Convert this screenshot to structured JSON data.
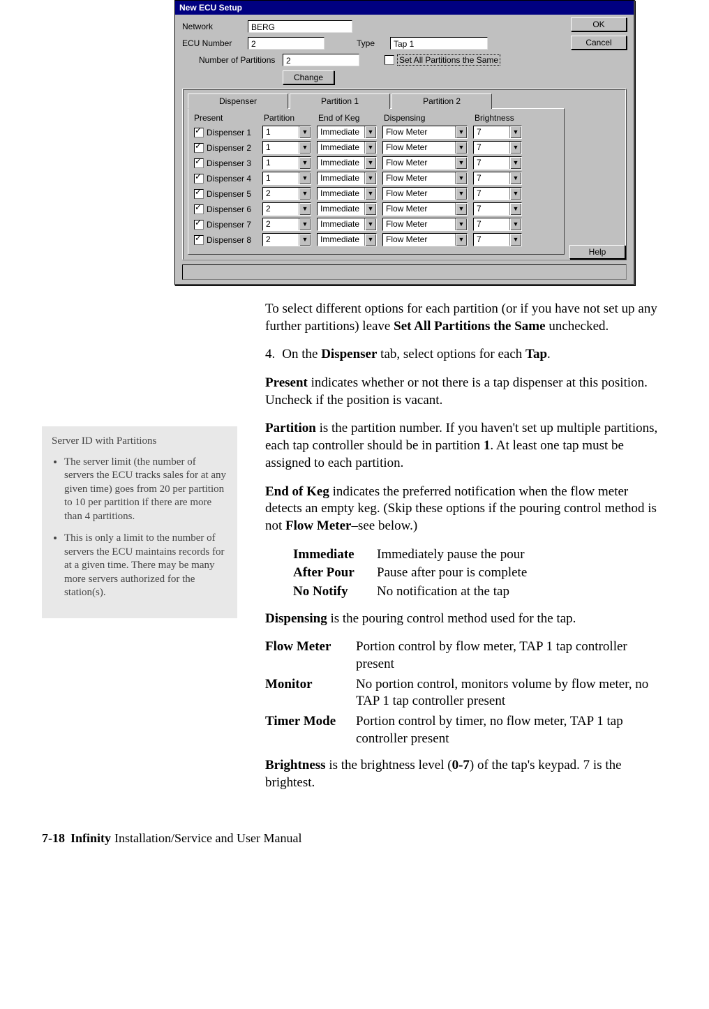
{
  "dialog": {
    "title": "New ECU Setup",
    "network_label": "Network",
    "network_value": "BERG",
    "ecu_num_label": "ECU Number",
    "ecu_num_value": "2",
    "type_label": "Type",
    "type_value": "Tap 1",
    "ok_label": "OK",
    "cancel_label": "Cancel",
    "help_label": "Help",
    "num_partitions_label": "Number of Partitions",
    "num_partitions_value": "2",
    "change_label": "Change",
    "set_all_label": "Set All Partitions the Same",
    "tabs": {
      "dispenser": "Dispenser",
      "p1": "Partition 1",
      "p2": "Partition 2"
    },
    "col_headers": {
      "present": "Present",
      "partition": "Partition",
      "eok": "End of Keg",
      "dispensing": "Dispensing",
      "brightness": "Brightness"
    },
    "rows": [
      {
        "name": "Dispenser 1",
        "partition": "1",
        "eok": "Immediate",
        "dispensing": "Flow Meter",
        "brightness": "7"
      },
      {
        "name": "Dispenser 2",
        "partition": "1",
        "eok": "Immediate",
        "dispensing": "Flow Meter",
        "brightness": "7"
      },
      {
        "name": "Dispenser 3",
        "partition": "1",
        "eok": "Immediate",
        "dispensing": "Flow Meter",
        "brightness": "7"
      },
      {
        "name": "Dispenser 4",
        "partition": "1",
        "eok": "Immediate",
        "dispensing": "Flow Meter",
        "brightness": "7"
      },
      {
        "name": "Dispenser 5",
        "partition": "2",
        "eok": "Immediate",
        "dispensing": "Flow Meter",
        "brightness": "7"
      },
      {
        "name": "Dispenser 6",
        "partition": "2",
        "eok": "Immediate",
        "dispensing": "Flow Meter",
        "brightness": "7"
      },
      {
        "name": "Dispenser 7",
        "partition": "2",
        "eok": "Immediate",
        "dispensing": "Flow Meter",
        "brightness": "7"
      },
      {
        "name": "Dispenser 8",
        "partition": "2",
        "eok": "Immediate",
        "dispensing": "Flow Meter",
        "brightness": "7"
      }
    ]
  },
  "doc": {
    "para_intro_1": "To select different options for each partition (or if you have not set up any further partitions) leave ",
    "para_intro_bold": "Set All Partitions the Same",
    "para_intro_2": " unchecked.",
    "step_num": "4.",
    "step_1a": "On the ",
    "step_1b": "Dispenser",
    "step_1c": " tab, select options for each ",
    "step_1d": "Tap",
    "step_1e": ".",
    "present_b": "Present",
    "present_t": " indicates whether or not there is a tap dispenser at this position. Uncheck if the position is vacant.",
    "partition_b": "Partition",
    "partition_t1": " is the partition number. If you haven't set up multiple partitions, each tap controller should be in partition ",
    "partition_t1b": "1",
    "partition_t2": ". At least one tap must be assigned to each partition.",
    "eok_b": "End of Keg",
    "eok_t1": " indicates the preferred notification when the flow meter detects an empty keg. (Skip these options if the pouring control method is not ",
    "eok_t1b": "Flow Meter",
    "eok_t2": "–see below.)",
    "def_immediate": "Immediate",
    "def_immediate_t": "Immediately pause the pour",
    "def_after": "After Pour",
    "def_after_t": "Pause after pour is complete",
    "def_no": "No Notify",
    "def_no_t": "No notification at the tap",
    "dispensing_b": "Dispensing",
    "dispensing_t": " is the pouring control method used for the tap.",
    "def_flow": "Flow Meter",
    "def_flow_t": "Portion control by flow meter, TAP 1 tap controller present",
    "def_monitor": "Monitor",
    "def_monitor_t": "No portion control, monitors volume by flow meter, no TAP 1 tap controller present",
    "def_timer": "Timer Mode",
    "def_timer_t": "Portion control by timer, no flow meter, TAP 1 tap controller present",
    "brightness_b": "Brightness",
    "brightness_t1": " is the brightness level (",
    "brightness_t1b": "0-7",
    "brightness_t2": ") of the tap's keypad. 7 is the brightest."
  },
  "sidebar": {
    "title": "Server ID with Partitions",
    "bullet1": "The server limit (the number of servers the ECU tracks sales for at any given time) goes from 20 per partition to 10 per partition if there are more than 4 partitions.",
    "bullet2": "This is only a limit to the number of servers the ECU maintains records for at a given time. There may be many more servers authorized for the station(s)."
  },
  "footer": {
    "page": "7-18",
    "product": "Infinity",
    "rest": " Installation/Service and User Manual"
  }
}
